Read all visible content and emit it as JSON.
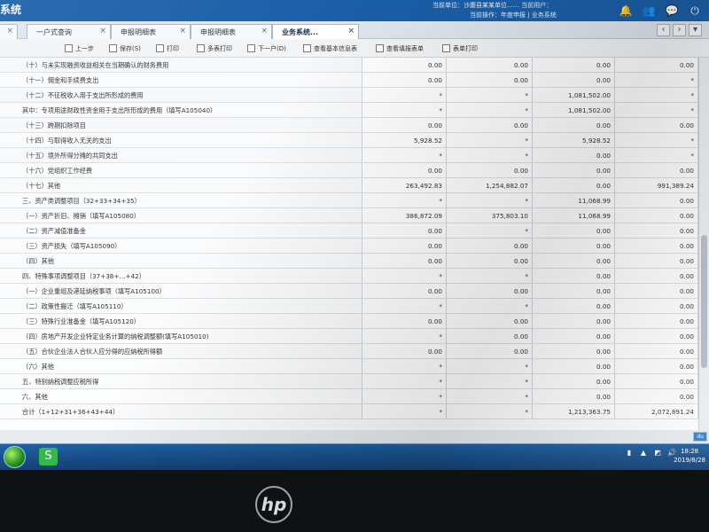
{
  "header": {
    "app_title": "系统",
    "user_line_1": "当前单位：沙腹县某某单位…… 当前用户：",
    "user_line_2": "当前操作：年度申报 | 业务系统",
    "icons": [
      "bell-icon",
      "users-icon",
      "message-icon",
      "power-icon"
    ]
  },
  "tabs": [
    {
      "label": "一户式查询"
    },
    {
      "label": "申报明细表"
    },
    {
      "label": "申报明细表"
    },
    {
      "label": "业务系统..."
    }
  ],
  "toolbar": {
    "items": [
      "上一步",
      "保存(S)",
      "打印",
      "多表打印",
      "下一户(D)",
      "查看基本信息表",
      "查看填报表单",
      "表单打印"
    ]
  },
  "table": {
    "rows": [
      {
        "label": "（十）与未实现融资收益相关在当期确认的财务费用",
        "c1": "0.00",
        "c2": "0.00",
        "c3": "0.00",
        "c4": "0.00"
      },
      {
        "label": "（十一）佣金和手续费支出",
        "c1": "0.00",
        "c2": "0.00",
        "c3": "0.00",
        "c4": "*"
      },
      {
        "label": "（十二）不征税收入用于支出所形成的费用",
        "c1": "*",
        "c2": "*",
        "c3": "1,081,502.00",
        "c4": "*"
      },
      {
        "label": "其中：专项用途财政性资金用于支出所形成的费用（填写A105040）",
        "c1": "*",
        "c2": "*",
        "c3": "1,081,502.00",
        "c4": "*"
      },
      {
        "label": "（十三）跨期扣除项目",
        "c1": "0.00",
        "c2": "0.00",
        "c3": "0.00",
        "c4": "0.00"
      },
      {
        "label": "（十四）与取得收入无关的支出",
        "c1": "5,928.52",
        "c2": "*",
        "c3": "5,928.52",
        "c4": "*"
      },
      {
        "label": "（十五）境外所得分摊的共同支出",
        "c1": "*",
        "c2": "*",
        "c3": "0.00",
        "c4": "*"
      },
      {
        "label": "（十六）党组织工作经费",
        "c1": "0.00",
        "c2": "0.00",
        "c3": "0.00",
        "c4": "0.00"
      },
      {
        "label": "（十七）其他",
        "c1": "263,492.83",
        "c2": "1,254,882.07",
        "c3": "0.00",
        "c4": "991,389.24"
      },
      {
        "label": "三、资产类调整项目（32+33+34+35）",
        "c1": "*",
        "c2": "*",
        "c3": "11,068.99",
        "c4": "0.00"
      },
      {
        "label": "（一）资产折旧、摊销（填写A105080）",
        "c1": "386,872.09",
        "c2": "375,803.10",
        "c3": "11,068.99",
        "c4": "0.00"
      },
      {
        "label": "（二）资产减值准备金",
        "c1": "0.00",
        "c2": "*",
        "c3": "0.00",
        "c4": "0.00"
      },
      {
        "label": "（三）资产损失（填写A105090）",
        "c1": "0.00",
        "c2": "0.00",
        "c3": "0.00",
        "c4": "0.00"
      },
      {
        "label": "（四）其他",
        "c1": "0.00",
        "c2": "0.00",
        "c3": "0.00",
        "c4": "0.00"
      },
      {
        "label": "四、特殊事项调整项目（37+38+…+42）",
        "c1": "*",
        "c2": "*",
        "c3": "0.00",
        "c4": "0.00"
      },
      {
        "label": "（一）企业重组及递延纳税事项（填写A105100）",
        "c1": "0.00",
        "c2": "0.00",
        "c3": "0.00",
        "c4": "0.00"
      },
      {
        "label": "（二）政策性搬迁（填写A105110）",
        "c1": "*",
        "c2": "*",
        "c3": "0.00",
        "c4": "0.00"
      },
      {
        "label": "（三）特殊行业准备金（填写A105120）",
        "c1": "0.00",
        "c2": "0.00",
        "c3": "0.00",
        "c4": "0.00"
      },
      {
        "label": "（四）房地产开发企业特定业务计算的纳税调整额(填写A105010)",
        "c1": "*",
        "c2": "0.00",
        "c3": "0.00",
        "c4": "0.00"
      },
      {
        "label": "（五）合伙企业法人合伙人应分得的应纳税所得额",
        "c1": "0.00",
        "c2": "0.00",
        "c3": "0.00",
        "c4": "0.00"
      },
      {
        "label": "（六）其他",
        "c1": "*",
        "c2": "*",
        "c3": "0.00",
        "c4": "0.00"
      },
      {
        "label": "五、特别纳税调整应税所得",
        "c1": "*",
        "c2": "*",
        "c3": "0.00",
        "c4": "0.00"
      },
      {
        "label": "六、其他",
        "c1": "*",
        "c2": "*",
        "c3": "0.00",
        "c4": "0.00"
      },
      {
        "label": "合计（1+12+31+36+43+44）",
        "c1": "*",
        "c2": "*",
        "c3": "1,213,363.75",
        "c4": "2,072,891.24"
      }
    ]
  },
  "taskbar": {
    "time": "18:28",
    "date": "2019/8/28",
    "badge": "du"
  },
  "monitor": {
    "brand": "hp"
  }
}
